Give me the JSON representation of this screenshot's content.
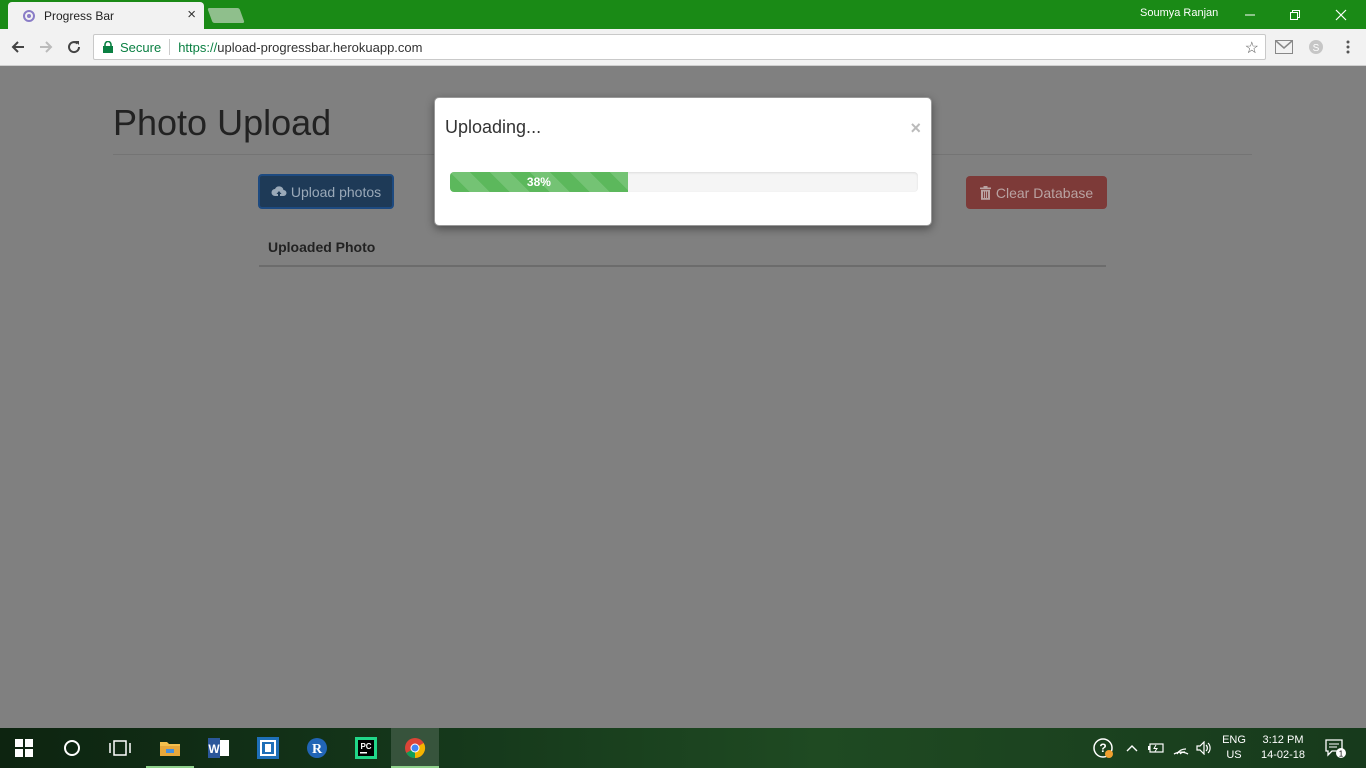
{
  "browser": {
    "tab_title": "Progress Bar",
    "tab_close": "×",
    "user_name": "Soumya Ranjan",
    "secure_label": "Secure",
    "url_scheme": "https://",
    "url_rest": "upload-progressbar.herokuapp.com"
  },
  "page": {
    "title": "Photo Upload",
    "upload_button": "Upload photos",
    "clear_button": "Clear Database",
    "table_header": "Uploaded Photo"
  },
  "modal": {
    "title": "Uploading...",
    "close": "×",
    "progress_percent": 38,
    "progress_label": "38%"
  },
  "taskbar": {
    "lang_top": "ENG",
    "lang_bottom": "US",
    "time": "3:12 PM",
    "date": "14-02-18",
    "notification_count": "1"
  },
  "colors": {
    "titlebar": "#1a8a16",
    "progress": "#5cb85c",
    "upload_button": "#1e3a57",
    "clear_button": "#7d3a38"
  },
  "icons": [
    "back-arrow-icon",
    "forward-arrow-icon",
    "reload-icon",
    "lock-icon",
    "star-icon",
    "gmail-icon",
    "skype-icon",
    "menu-icon",
    "cloud-upload-icon",
    "trash-icon",
    "windows-start-icon",
    "cortana-icon",
    "task-view-icon",
    "file-explorer-icon",
    "word-icon",
    "app-icon",
    "r-icon",
    "pycharm-icon",
    "chrome-icon",
    "help-icon",
    "chevron-up-icon",
    "battery-icon",
    "wifi-icon",
    "volume-icon",
    "notification-icon"
  ]
}
